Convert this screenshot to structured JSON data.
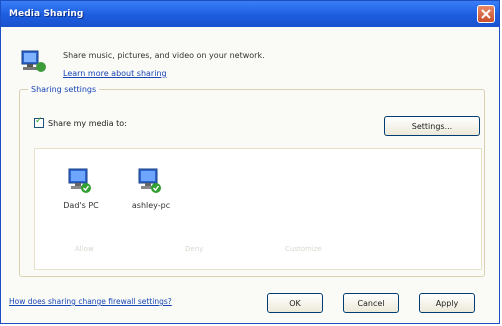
{
  "window": {
    "title": "Media Sharing"
  },
  "header": {
    "description": "Share music, pictures, and video on your network.",
    "learn_link": "Learn more about sharing"
  },
  "group": {
    "label": "Sharing settings",
    "share_checkbox_label": "Share my media to:",
    "share_checked": true,
    "settings_button": "Settings..."
  },
  "devices": [
    {
      "name": "Dad's PC",
      "icon": "computer-icon"
    },
    {
      "name": "ashley-pc",
      "icon": "computer-icon"
    }
  ],
  "faded_labels": [
    "Allow",
    "Deny",
    "Customize"
  ],
  "footer": {
    "help_link": "How does sharing change firewall settings?",
    "ok": "OK",
    "cancel": "Cancel",
    "apply": "Apply"
  }
}
